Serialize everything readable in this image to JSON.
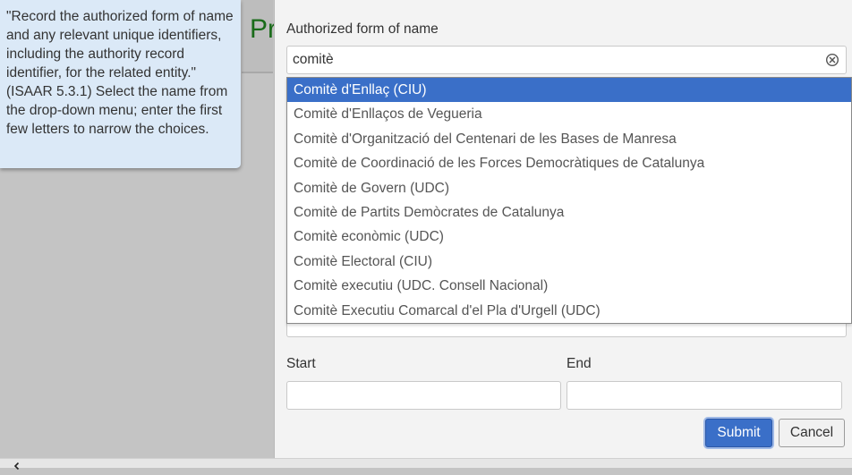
{
  "background": {
    "page_title_peek": "Pr"
  },
  "help_tooltip": {
    "text": "\"Record the authorized form of name and any relevant unique identifiers, including the authority record identifier, for the related entity.\" (ISAAR 5.3.1) Select the name from the drop-down menu; enter the first few letters to narrow the choices."
  },
  "form": {
    "authorized_name_label": "Authorized form of name",
    "authorized_name_value": "comitè",
    "options": [
      "Comitè d'Enllaç (CIU)",
      "Comitè d'Enllaços de Vegueria",
      "Comitè d'Organització del Centenari de les Bases de Manresa",
      "Comitè de Coordinació de les Forces Democràtiques de Catalunya",
      "Comitè de Govern (UDC)",
      "Comitè de Partits Demòcrates de Catalunya",
      "Comitè econòmic (UDC)",
      "Comitè Electoral (CIU)",
      "Comitè executiu (UDC. Consell Nacional)",
      "Comitè Executiu Comarcal d'el Pla d'Urgell (UDC)"
    ],
    "active_option_index": 0,
    "start_label": "Start",
    "start_value": "",
    "end_label": "End",
    "end_value": ""
  },
  "buttons": {
    "submit": "Submit",
    "cancel": "Cancel"
  },
  "colors": {
    "accent": "#3a6fc8",
    "tooltip_bg": "#dbe9f7",
    "title_green": "#1a6b1a"
  },
  "icons": {
    "clear": "clear-circle-x-icon",
    "scroll_left": "chevron-left-icon"
  }
}
